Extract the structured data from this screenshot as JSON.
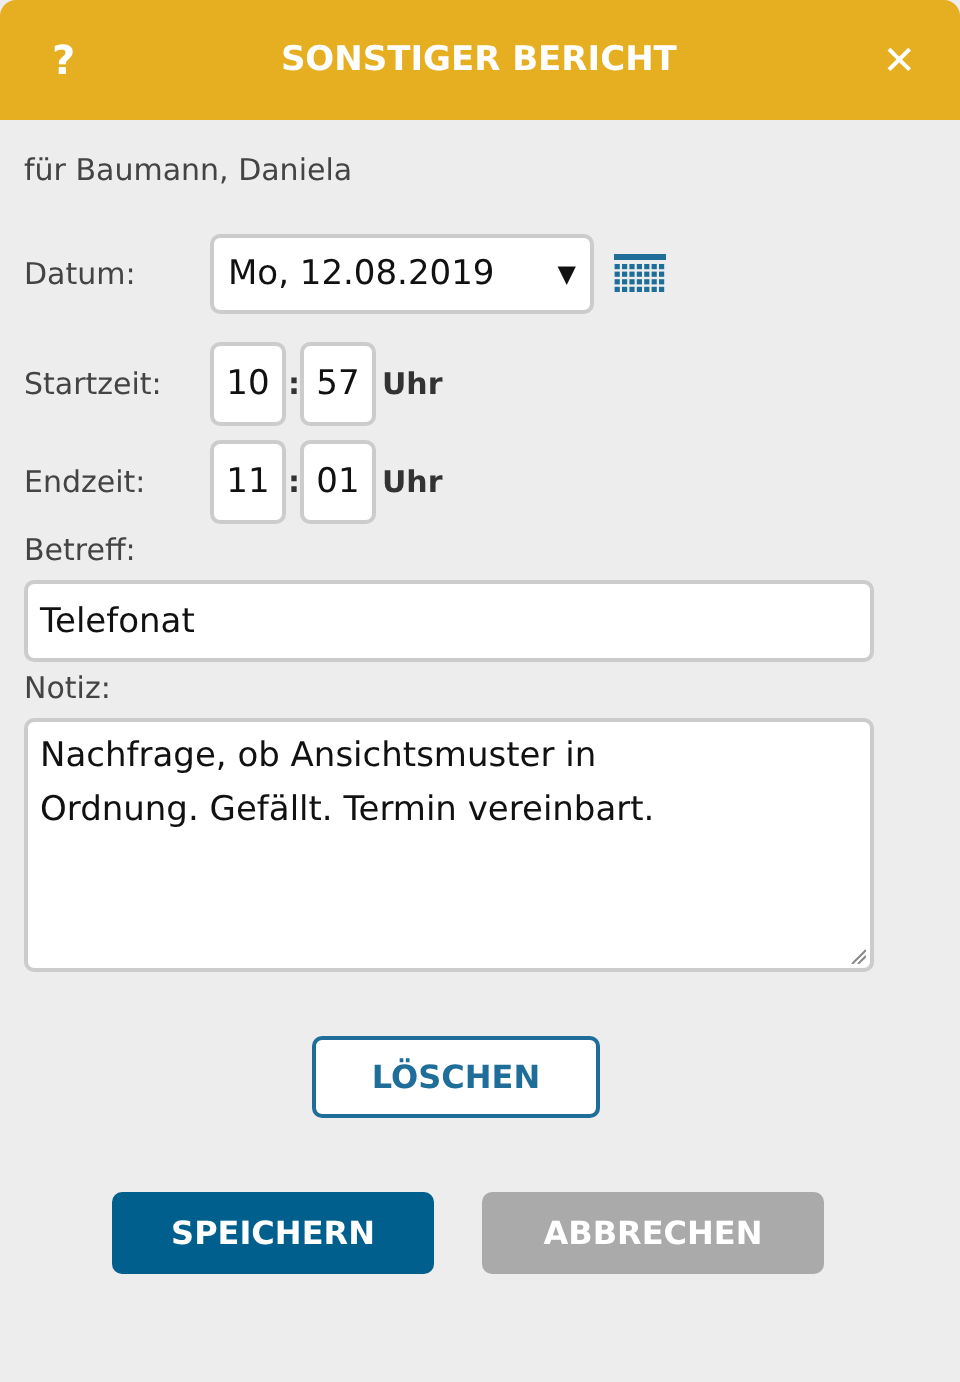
{
  "dialog": {
    "title": "SONSTIGER BERICHT",
    "help": "?",
    "close": "✕"
  },
  "subtitle": "für Baumann, Daniela",
  "date": {
    "label": "Datum:",
    "value": "Mo, 12.08.2019",
    "caret": "▼"
  },
  "times": [
    {
      "label": "Startzeit:",
      "hour": "10",
      "sep": ":",
      "minute": "57",
      "unit": "Uhr"
    },
    {
      "label": "Endzeit:",
      "hour": "11",
      "sep": ":",
      "minute": "01",
      "unit": "Uhr"
    }
  ],
  "subject": {
    "label": "Betreff:",
    "value": "Telefonat"
  },
  "note": {
    "label": "Notiz:",
    "value": "Nachfrage, ob Ansichtsmuster in Ordnung. Gefällt. Termin vereinbart."
  },
  "delete_button": {
    "label": "LÖSCHEN"
  },
  "buttons": [
    {
      "label": "SPEICHERN",
      "disabled": false
    },
    {
      "label": "ABBRECHEN",
      "disabled": true
    }
  ]
}
